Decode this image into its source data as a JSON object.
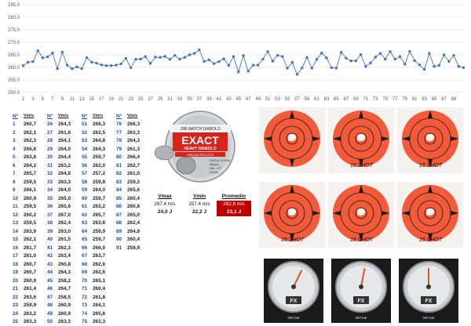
{
  "chart_data": {
    "type": "line",
    "ylim": [
      250,
      285
    ],
    "yticks": [
      "250,0",
      "255,0",
      "260,0",
      "265,0",
      "270,0",
      "275,0",
      "280,0",
      "285,0"
    ],
    "xtick_labels": [
      "1",
      "3",
      "5",
      "7",
      "9",
      "11",
      "13",
      "15",
      "17",
      "19",
      "21",
      "23",
      "25",
      "27",
      "29",
      "31",
      "33",
      "35",
      "37",
      "39",
      "41",
      "43",
      "45",
      "47",
      "49",
      "51",
      "53",
      "55",
      "57",
      "59",
      "61",
      "63",
      "65",
      "67",
      "69",
      "71",
      "73",
      "75",
      "77",
      "79",
      "81",
      "83",
      "85",
      "87",
      "89"
    ],
    "series": [
      {
        "color": "#4472c4",
        "values": [
          260.7,
          262.1,
          262.3,
          266.6,
          263.8,
          264.2,
          265.7,
          259.5,
          266.1,
          260.9,
          259.5,
          260.2,
          259.5,
          263.9,
          262.1,
          261.7,
          261.0,
          260.7,
          260.7,
          260.9,
          261.4,
          263.6,
          259.9,
          263.2,
          263.3,
          264.3,
          261.6,
          264.1,
          264.0,
          264.4,
          263.2,
          264.8,
          263.3,
          264.0,
          265.0,
          265.6,
          267.0,
          262.4,
          263.0,
          261.5,
          262.3,
          263.4,
          260.8,
          264.3,
          258.2,
          264.7,
          258.5,
          260.9,
          260.9,
          263.3,
          266.3,
          262.5,
          264.8,
          264.3,
          259.7,
          262.0,
          257.2,
          259.8,
          264.0,
          259.7,
          263.2,
          265.7,
          263.8,
          259.9,
          259.7,
          266.0,
          263.7,
          262.6,
          262.6,
          265.1,
          260.4,
          261.8,
          264.1,
          265.6,
          263.3,
          266.3,
          263.3,
          264.3,
          261.3,
          266.4,
          262.7,
          261.0,
          259.2,
          265.6,
          260.4,
          260.8,
          265.0,
          262.4,
          264.8,
          260.4,
          259.9
        ]
      }
    ]
  },
  "table": {
    "header": {
      "num": "Nº",
      "unit": "Vm/s"
    },
    "columns": [
      [
        [
          "1",
          "260,7"
        ],
        [
          "2",
          "262,1"
        ],
        [
          "3",
          "262,3"
        ],
        [
          "4",
          "266,6"
        ],
        [
          "5",
          "263,8"
        ],
        [
          "6",
          "264,2"
        ],
        [
          "7",
          "265,7"
        ],
        [
          "8",
          "259,5"
        ],
        [
          "9",
          "266,1"
        ],
        [
          "10",
          "260,9"
        ],
        [
          "11",
          "259,5"
        ],
        [
          "12",
          "260,2"
        ],
        [
          "13",
          "259,5"
        ],
        [
          "14",
          "263,9"
        ],
        [
          "15",
          "262,1"
        ],
        [
          "16",
          "261,7"
        ],
        [
          "17",
          "261,0"
        ],
        [
          "18",
          "260,7"
        ],
        [
          "19",
          "260,7"
        ],
        [
          "20",
          "260,9"
        ],
        [
          "21",
          "261,4"
        ],
        [
          "22",
          "263,6"
        ],
        [
          "23",
          "259,9"
        ],
        [
          "24",
          "263,2"
        ],
        [
          "25",
          "263,3"
        ]
      ],
      [
        [
          "26",
          "264,3"
        ],
        [
          "27",
          "261,6"
        ],
        [
          "28",
          "264,1"
        ],
        [
          "29",
          "264,0"
        ],
        [
          "30",
          "264,4"
        ],
        [
          "31",
          "263,2"
        ],
        [
          "32",
          "264,8"
        ],
        [
          "33",
          "263,3"
        ],
        [
          "34",
          "264,0"
        ],
        [
          "35",
          "265,0"
        ],
        [
          "36",
          "265,6"
        ],
        [
          "37",
          "267,0"
        ],
        [
          "38",
          "262,4"
        ],
        [
          "39",
          "263,0"
        ],
        [
          "40",
          "261,5"
        ],
        [
          "41",
          "262,3"
        ],
        [
          "42",
          "263,4"
        ],
        [
          "43",
          "260,8"
        ],
        [
          "44",
          "264,3"
        ],
        [
          "45",
          "258,2"
        ],
        [
          "46",
          "264,7"
        ],
        [
          "47",
          "258,5"
        ],
        [
          "48",
          "260,9"
        ],
        [
          "49",
          "260,9"
        ],
        [
          "50",
          "263,3"
        ]
      ],
      [
        [
          "51",
          "266,3"
        ],
        [
          "52",
          "262,5"
        ],
        [
          "53",
          "264,8"
        ],
        [
          "54",
          "264,3"
        ],
        [
          "55",
          "259,7"
        ],
        [
          "56",
          "262,0"
        ],
        [
          "57",
          "257,2"
        ],
        [
          "58",
          "259,8"
        ],
        [
          "59",
          "264,0"
        ],
        [
          "60",
          "259,7"
        ],
        [
          "61",
          "263,2"
        ],
        [
          "62",
          "265,7"
        ],
        [
          "63",
          "263,8"
        ],
        [
          "64",
          "259,9"
        ],
        [
          "65",
          "259,7"
        ],
        [
          "66",
          "266,0"
        ],
        [
          "67",
          "263,7"
        ],
        [
          "68",
          "262,6"
        ],
        [
          "69",
          "262,6"
        ],
        [
          "70",
          "265,1"
        ],
        [
          "71",
          "260,4"
        ],
        [
          "72",
          "261,8"
        ],
        [
          "73",
          "264,1"
        ],
        [
          "74",
          "265,6"
        ],
        [
          "75",
          "263,3"
        ]
      ],
      [
        [
          "76",
          "266,3"
        ],
        [
          "77",
          "263,3"
        ],
        [
          "78",
          "264,3"
        ],
        [
          "79",
          "261,3"
        ],
        [
          "80",
          "266,4"
        ],
        [
          "81",
          "262,7"
        ],
        [
          "82",
          "261,0"
        ],
        [
          "83",
          "259,2"
        ],
        [
          "84",
          "265,6"
        ],
        [
          "85",
          "260,4"
        ],
        [
          "86",
          "260,8"
        ],
        [
          "87",
          "265,0"
        ],
        [
          "88",
          "262,4"
        ],
        [
          "89",
          "264,8"
        ],
        [
          "90",
          "260,4"
        ],
        [
          "91",
          "259,9"
        ]
      ]
    ]
  },
  "pellet": {
    "brand": "JSB MATCH DIABOLO",
    "title": "EXACT",
    "sub": "HEAVY DIABOLO",
    "type": "AIRGUN PELLETS",
    "specs": "0,670 g / 10,34 gr",
    "count": "500 pcs",
    "cal": "CAL. .177",
    "mm": "4,5 mm"
  },
  "stats": {
    "vmax": {
      "label": "Vmax",
      "speed": "267,4 m/s",
      "energy": "24,0 J"
    },
    "vmin": {
      "label": "Vmin",
      "speed": "257,4 m/s",
      "energy": "22,2 J"
    },
    "avg": {
      "label": "Promedio",
      "speed": "262,8 m/s",
      "energy": "23,1 J"
    }
  },
  "targets": [
    {
      "label": ""
    },
    {
      "label": "15 SHOT"
    },
    {
      "label": "15 SHOT"
    },
    {
      "label": "15 SHOT"
    },
    {
      "label": "15 SHOT"
    },
    {
      "label": "15 SHOT"
    }
  ],
  "gauges": [
    {
      "brand": "FX",
      "text": "250 bar",
      "level": 0.62
    },
    {
      "brand": "FX",
      "text": "250 bar",
      "level": 0.55
    },
    {
      "brand": "FX",
      "text": "250 bar",
      "level": 0.5
    }
  ]
}
